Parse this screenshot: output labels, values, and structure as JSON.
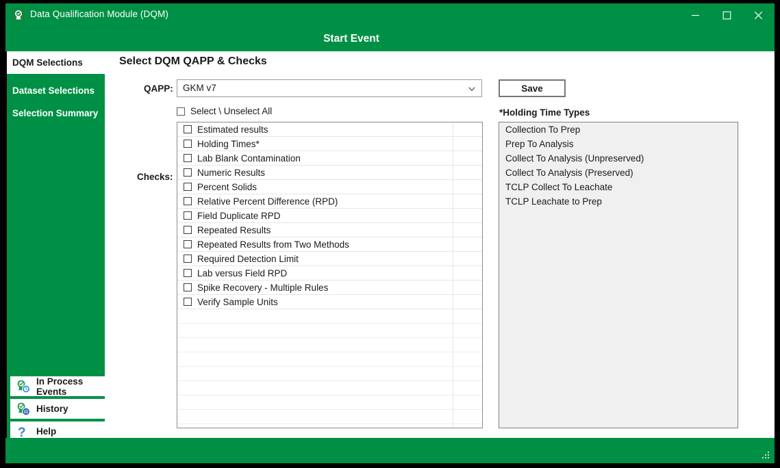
{
  "window": {
    "title": "Data Qualification Module (DQM)",
    "app_icon": "award-badge-icon",
    "minimize_label": "—",
    "maximize_label": "□",
    "close_label": "✕",
    "resize_grip": "resize-grip-icon",
    "accent_color": "#009045"
  },
  "header": {
    "title": "Start Event"
  },
  "sidebar": {
    "items": [
      {
        "label": "DQM Selections",
        "active": true
      },
      {
        "label": "Dataset Selections",
        "active": false
      },
      {
        "label": "Selection Summary",
        "active": false
      }
    ],
    "bottom_items": [
      {
        "label": "In Process Events",
        "icon": "badge-clock-icon"
      },
      {
        "label": "History",
        "icon": "badge-history-icon"
      },
      {
        "label": "Help",
        "icon": "question-mark-icon"
      }
    ]
  },
  "main": {
    "section_heading": "Select DQM QAPP & Checks",
    "qapp": {
      "label": "QAPP:",
      "value": "GKM v7",
      "arrow_icon": "chevron-down-icon"
    },
    "save_label": "Save",
    "select_all": {
      "label": "Select \\ Unselect All",
      "checked": false
    },
    "checks_label": "Checks:",
    "checks": [
      {
        "label": "Estimated results",
        "checked": false
      },
      {
        "label": "Holding Times*",
        "checked": false
      },
      {
        "label": "Lab Blank Contamination",
        "checked": false
      },
      {
        "label": "Numeric Results",
        "checked": false
      },
      {
        "label": "Percent Solids",
        "checked": false
      },
      {
        "label": "Relative Percent Difference (RPD)",
        "checked": false
      },
      {
        "label": "Field Duplicate RPD",
        "checked": false
      },
      {
        "label": "Repeated Results",
        "checked": false
      },
      {
        "label": "Repeated Results from Two Methods",
        "checked": false
      },
      {
        "label": "Required Detection Limit",
        "checked": false
      },
      {
        "label": "Lab versus Field RPD",
        "checked": false
      },
      {
        "label": "Spike Recovery - Multiple Rules",
        "checked": false
      },
      {
        "label": "Verify Sample Units",
        "checked": false
      }
    ],
    "checks_empty_rows": 8,
    "holding_times": {
      "label": "*Holding Time Types",
      "items": [
        "Collection To Prep",
        "Prep To Analysis",
        "Collect To Analysis (Unpreserved)",
        "Collect To Analysis (Preserved)",
        "TCLP Collect To Leachate",
        "TCLP Leachate to Prep"
      ]
    }
  }
}
